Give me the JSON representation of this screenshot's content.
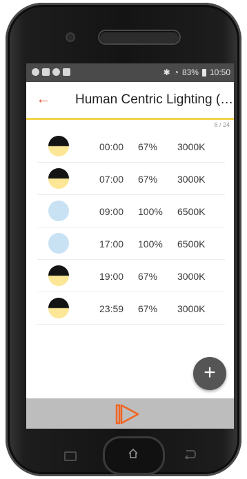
{
  "status": {
    "signal_text": "83%",
    "clock": "10:50"
  },
  "app": {
    "back_glyph": "←",
    "title": "Human Centric Lighting (…"
  },
  "pager": "6 / 24",
  "entries": [
    {
      "icon": "half-moon-icon",
      "time": "00:00",
      "level": "67%",
      "temperature": "3000K"
    },
    {
      "icon": "half-moon-icon",
      "time": "07:00",
      "level": "67%",
      "temperature": "3000K"
    },
    {
      "icon": "daylight-icon",
      "time": "09:00",
      "level": "100%",
      "temperature": "6500K"
    },
    {
      "icon": "daylight-icon",
      "time": "17:00",
      "level": "100%",
      "temperature": "6500K"
    },
    {
      "icon": "half-moon-icon",
      "time": "19:00",
      "level": "67%",
      "temperature": "3000K"
    },
    {
      "icon": "half-moon-icon",
      "time": "23:59",
      "level": "67%",
      "temperature": "3000K"
    }
  ],
  "fab_label": "+",
  "colors": {
    "accent": "#e8563a",
    "appbar_underline": "#f2d64b",
    "fab": "#555555",
    "bottom_bar": "#bdbdbd"
  },
  "icons": {
    "play": "play-icon",
    "home": "home-icon",
    "recent": "recent-apps-icon",
    "back": "back-nav-icon"
  }
}
